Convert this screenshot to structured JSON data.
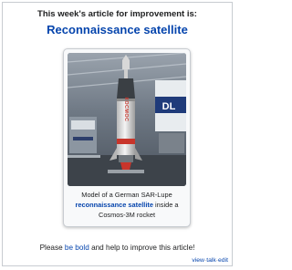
{
  "header": {
    "heading": "This week's article for improvement is:",
    "article_title": "Reconnaissance satellite"
  },
  "image": {
    "rocket_text": "КОСМОС",
    "banner_text": "DL"
  },
  "caption": {
    "prefix": "Model of a German SAR-Lupe",
    "link": "reconnaissance satellite",
    "middle": "inside a",
    "suffix": "Cosmos-3M rocket"
  },
  "footer": {
    "prefix": "Please",
    "link": "be bold",
    "suffix": "and help to improve this article!"
  },
  "vte": {
    "view": "view",
    "talk": "talk",
    "edit": "edit",
    "separator": "·"
  },
  "colors": {
    "link": "#0645ad",
    "text": "#202122",
    "border": "#c8ccd1"
  }
}
